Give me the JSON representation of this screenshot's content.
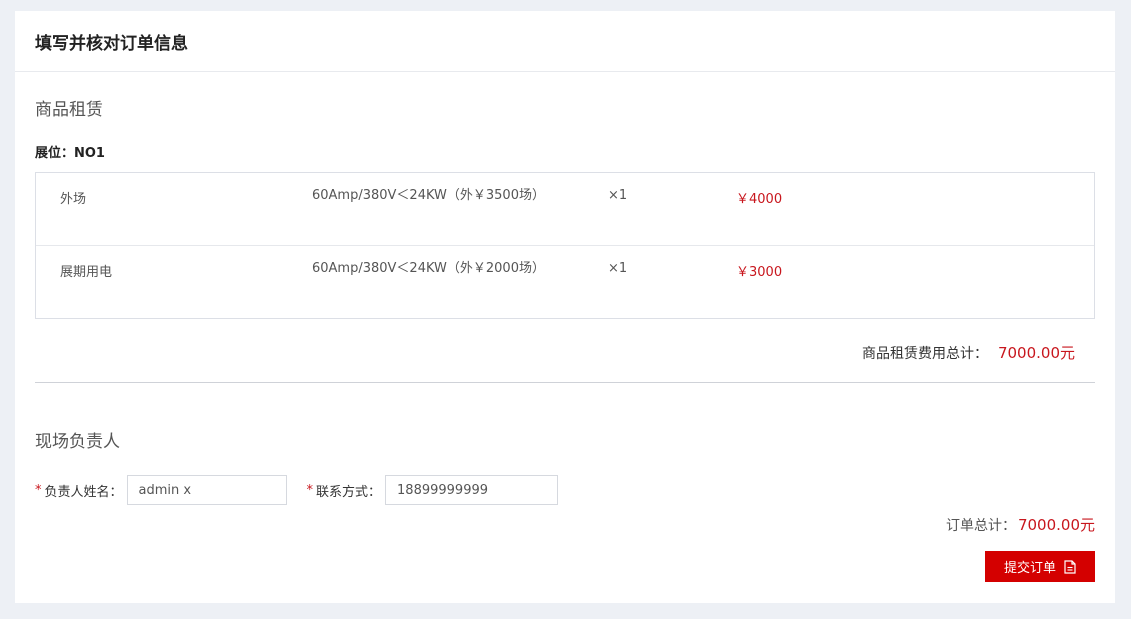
{
  "card": {
    "title": "填写并核对订单信息"
  },
  "rental": {
    "section_title": "商品租赁",
    "booth_label": "展位：NO1",
    "items": [
      {
        "name": "外场",
        "spec": "60Amp/380V＜24KW（外￥3500场）",
        "qty": "×1",
        "price": "￥4000"
      },
      {
        "name": "展期用电",
        "spec": "60Amp/380V＜24KW（外￥2000场）",
        "qty": "×1",
        "price": "￥3000"
      }
    ],
    "subtotal_label": "商品租赁费用总计：",
    "subtotal_value": "7000.00元"
  },
  "contact": {
    "section_title": "现场负责人",
    "required_mark": "*",
    "name_label": "负责人姓名：",
    "name_value": "admin x",
    "phone_label": "联系方式：",
    "phone_value": "18899999999"
  },
  "order": {
    "total_label": "订单总计：",
    "total_value": "7000.00元",
    "submit_label": "提交订单",
    "submit_icon": "document-icon"
  },
  "colors": {
    "accent": "#d40000",
    "price": "#c8161d",
    "background": "#edf0f5"
  }
}
